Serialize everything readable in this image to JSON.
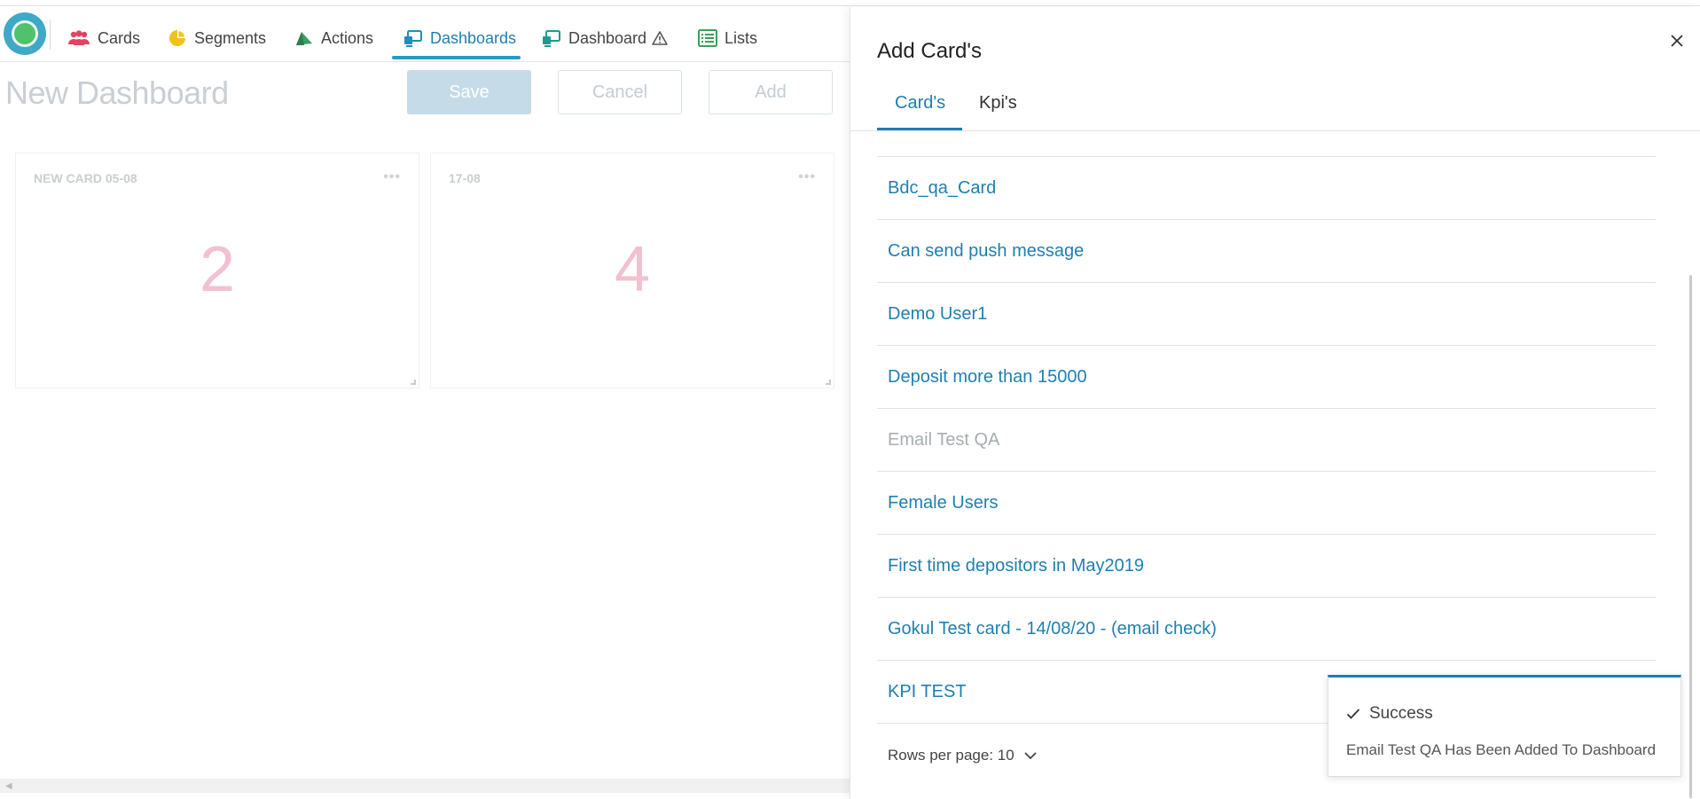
{
  "nav": {
    "items": [
      {
        "label": "Cards",
        "icon": "users-icon"
      },
      {
        "label": "Segments",
        "icon": "pie-chart-icon"
      },
      {
        "label": "Actions",
        "icon": "megaphone-icon"
      },
      {
        "label": "Dashboards",
        "icon": "dashboard-icon",
        "active": true
      },
      {
        "label": "Dashboard",
        "icon": "dashboard-icon",
        "badge_icon": "warning-icon"
      },
      {
        "label": "Lists",
        "icon": "list-icon"
      }
    ],
    "accent_color": "#1f7fb0"
  },
  "page": {
    "title": "New Dashboard",
    "save_label": "Save",
    "cancel_label": "Cancel",
    "add_label": "Add"
  },
  "cards": [
    {
      "title": "NEW CARD 05-08",
      "value": "2"
    },
    {
      "title": "17-08",
      "value": "4"
    }
  ],
  "drawer": {
    "title": "Add Card's",
    "tabs": [
      {
        "label": "Card's",
        "active": true
      },
      {
        "label": "Kpi's"
      }
    ],
    "rows": [
      {
        "label": "Bdc_qa_Card"
      },
      {
        "label": "Can send push message"
      },
      {
        "label": "Demo User1"
      },
      {
        "label": "Deposit more than 15000"
      },
      {
        "label": "Email Test QA",
        "disabled": true
      },
      {
        "label": "Female Users"
      },
      {
        "label": "First time depositors in May2019"
      },
      {
        "label": "Gokul Test card - 14/08/20 - (email check)"
      },
      {
        "label": "KPI TEST"
      }
    ],
    "rows_per_page_label": "Rows per page: 10"
  },
  "toast": {
    "title": "Success",
    "message": "Email Test QA Has Been Added To Dashboard"
  }
}
